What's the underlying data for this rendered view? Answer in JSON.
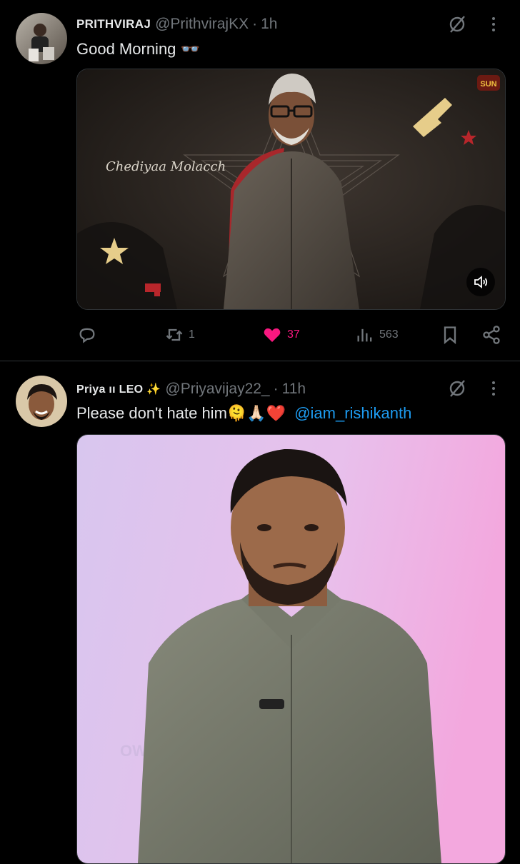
{
  "post1": {
    "display_name": "PRITHVIRAJ",
    "handle": "@PrithvirajKX",
    "separator": "·",
    "time": "1h",
    "text": "Good Morning 👓",
    "media_overlay_text": "Chediyaa Molacch",
    "media_brand": "SUN",
    "actions": {
      "replies": "",
      "reposts": "1",
      "likes": "37",
      "views": "563"
    },
    "like_color": "#f91880"
  },
  "post2": {
    "display_name": "Priya ıı LEO ✨",
    "handle": "@Priyavijay22_",
    "separator": "·",
    "time": "11h",
    "text": "Please don't hate him🫠🙏🏻❤️",
    "mention": "@iam_rishikanth",
    "media_watermark": "OW"
  },
  "colors": {
    "accent": "#1d9bf0",
    "muted": "#71767b",
    "background": "#000000",
    "divider": "#2f3336"
  }
}
